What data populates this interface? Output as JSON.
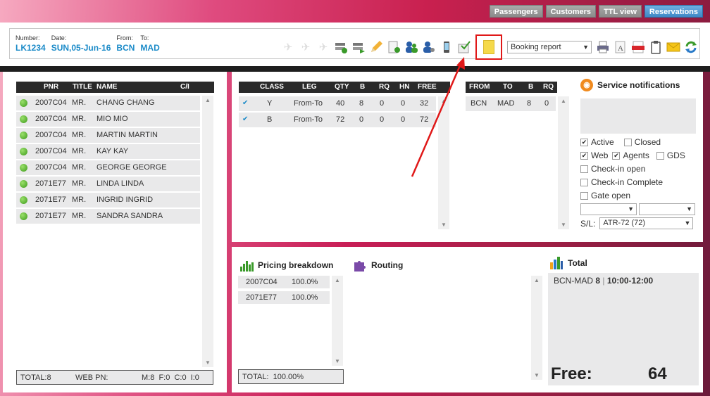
{
  "topnav": [
    {
      "label": "Passengers"
    },
    {
      "label": "Customers"
    },
    {
      "label": "TTL view"
    },
    {
      "label": "Reservations"
    }
  ],
  "flight": {
    "number_label": "Number:",
    "number": "LK1234",
    "date_label": "Date:",
    "date": "SUN,05-Jun-16",
    "from_label": "From:",
    "from": "BCN",
    "to_label": "To:",
    "to": "MAD"
  },
  "toolbar": {
    "report_select": "Booking report",
    "icons": [
      "plane-icon",
      "plane-icon",
      "plane-icon",
      "add-segment-icon",
      "move-segment-icon",
      "edit-pencil-icon",
      "add-document-icon",
      "group-users-icon",
      "user-settings-icon",
      "mobile-icon",
      "checkmark-doc-icon",
      "sticky-note-icon",
      "print-icon",
      "font-icon",
      "pdf-icon",
      "clipboard-icon",
      "mail-icon",
      "refresh-icon"
    ]
  },
  "passengers": {
    "headers": {
      "pnr": "PNR",
      "title": "TITLE",
      "name": "NAME",
      "ci": "C/I"
    },
    "rows": [
      {
        "pnr": "2007C04",
        "title": "MR.",
        "name": "CHANG CHANG"
      },
      {
        "pnr": "2007C04",
        "title": "MR.",
        "name": "MIO MIO"
      },
      {
        "pnr": "2007C04",
        "title": "MR.",
        "name": "MARTIN MARTIN"
      },
      {
        "pnr": "2007C04",
        "title": "MR.",
        "name": "KAY KAY"
      },
      {
        "pnr": "2007C04",
        "title": "MR.",
        "name": "GEORGE GEORGE"
      },
      {
        "pnr": "2071E77",
        "title": "MR.",
        "name": "LINDA LINDA"
      },
      {
        "pnr": "2071E77",
        "title": "MR.",
        "name": "INGRID INGRID"
      },
      {
        "pnr": "2071E77",
        "title": "MR.",
        "name": "SANDRA SANDRA"
      }
    ],
    "footer": {
      "total": "TOTAL:8",
      "web": "WEB PN:",
      "counts": "M:8  F:0  C:0  I:0"
    }
  },
  "classes": {
    "headers": {
      "cls": "CLASS",
      "leg": "LEG",
      "qty": "QTY",
      "b": "B",
      "rq": "RQ",
      "hn": "HN",
      "free": "FREE"
    },
    "rows": [
      {
        "cls": "Y",
        "leg": "From-To",
        "qty": "40",
        "b": "8",
        "rq": "0",
        "hn": "0",
        "free": "32"
      },
      {
        "cls": "B",
        "leg": "From-To",
        "qty": "72",
        "b": "0",
        "rq": "0",
        "hn": "0",
        "free": "72"
      }
    ]
  },
  "legs": {
    "headers": {
      "from": "FROM",
      "to": "TO",
      "b": "B",
      "rq": "RQ"
    },
    "rows": [
      {
        "from": "BCN",
        "to": "MAD",
        "b": "8",
        "rq": "0"
      }
    ]
  },
  "notifications": {
    "title": "Service notifications",
    "active": "Active",
    "closed": "Closed",
    "web": "Web",
    "agents": "Agents",
    "gds": "GDS",
    "checkin_open": "Check-in open",
    "checkin_complete": "Check-in Complete",
    "gate_open": "Gate open",
    "sl_label": "S/L:",
    "sl_value": "ATR-72 (72)"
  },
  "pricing": {
    "title": "Pricing breakdown",
    "rows": [
      {
        "pnr": "2007C04",
        "pct": "100.0%"
      },
      {
        "pnr": "2071E77",
        "pct": "100.0%"
      }
    ],
    "footer": "TOTAL:  100.00%"
  },
  "routing": {
    "title": "Routing"
  },
  "total": {
    "title": "Total",
    "route": "BCN-MAD",
    "count": "8",
    "time": "10:00-12:00",
    "free_label": "Free:",
    "free_value": "64"
  },
  "colors": {
    "accent": "#1a8ac8",
    "highlight": "#e01818"
  }
}
